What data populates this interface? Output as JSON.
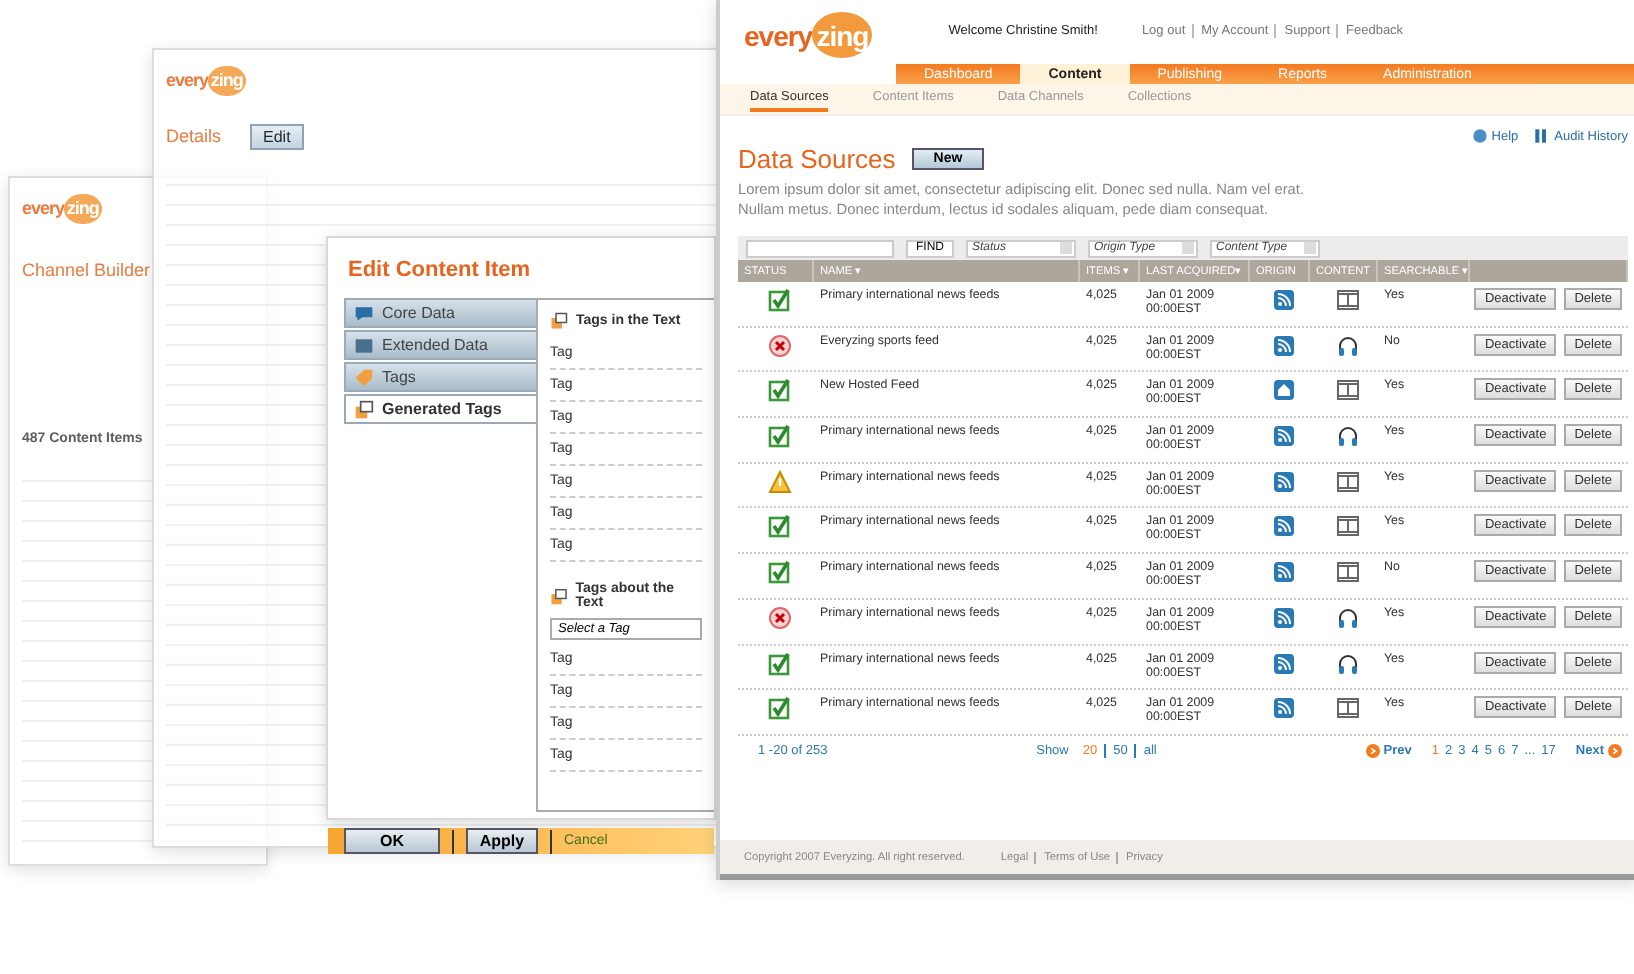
{
  "back_screens": [
    {
      "kind": "channel",
      "logo": {
        "word": "every",
        "mark": "zing"
      },
      "title": "Channel Builder",
      "subtitle": "487 Content Items"
    },
    {
      "kind": "details",
      "logo": {
        "word": "every",
        "mark": "zing"
      },
      "title": "Details",
      "button": "Edit"
    }
  ],
  "dialog": {
    "title": "Edit Content Item",
    "tabs": [
      {
        "label": "Core Data",
        "kind": "core",
        "selected": false
      },
      {
        "label": "Extended Data",
        "kind": "extended",
        "selected": false
      },
      {
        "label": "Tags",
        "kind": "tags",
        "selected": false
      },
      {
        "label": "Generated Tags",
        "kind": "generated",
        "selected": true
      }
    ],
    "sections": [
      {
        "title": "Tags in the Text",
        "tags": [
          "Tag",
          "Tag",
          "Tag",
          "Tag",
          "Tag",
          "Tag",
          "Tag"
        ]
      },
      {
        "title": "Tags about the Text",
        "select": "Select a Tag",
        "tags": [
          "Tag",
          "Tag",
          "Tag",
          "Tag"
        ]
      }
    ],
    "buttons": [
      "OK",
      "Apply"
    ],
    "cancel": "Cancel"
  },
  "main": {
    "logo": {
      "word": "every",
      "mark": "zing"
    },
    "welcome": "Welcome Christine Smith!",
    "links": [
      "Log out",
      "My Account",
      "Support",
      "Feedback"
    ],
    "tabs": [
      {
        "label": "Dashboard",
        "selected": false
      },
      {
        "label": "Content",
        "selected": true
      },
      {
        "label": "Publishing",
        "selected": false
      },
      {
        "label": "Reports",
        "selected": false
      },
      {
        "label": "Administration",
        "selected": false
      }
    ],
    "subtabs": [
      {
        "label": "Data Sources",
        "selected": true
      },
      {
        "label": "Content Items",
        "selected": false
      },
      {
        "label": "Data Channels",
        "selected": false
      },
      {
        "label": "Collections",
        "selected": false
      }
    ],
    "help": "Help",
    "audit": "Audit History",
    "title": "Data Sources",
    "new_button": "New",
    "description": "Lorem ipsum dolor sit amet, consectetur adipiscing elit. Donec sed nulla. Nam vel erat. Nullam metus. Donec interdum, lectus id sodales aliquam, pede diam consequat.",
    "find": "FIND",
    "filters": [
      "Status",
      "Origin Type",
      "Content Type"
    ],
    "columns": [
      "STATUS",
      "NAME ▾",
      "ITEMS ▾",
      "LAST ACQUIRED▾",
      "ORIGIN",
      "CONTENT",
      "SEARCHABLE ▾"
    ],
    "rows": [
      {
        "status": {
          "kind": "ok"
        },
        "name": "Primary international news feeds",
        "items": "4,025",
        "date": "Jan 01 2009",
        "time": "00:00EST",
        "origin": {
          "kind": "rss"
        },
        "content": {
          "kind": "video"
        },
        "searchable": "Yes",
        "actions": [
          "Deactivate",
          "Delete"
        ]
      },
      {
        "status": {
          "kind": "error"
        },
        "name": "Everyzing sports feed",
        "items": "4,025",
        "date": "Jan 01 2009",
        "time": "00:00EST",
        "origin": {
          "kind": "rss"
        },
        "content": {
          "kind": "audio"
        },
        "searchable": "No",
        "actions": [
          "Deactivate",
          "Delete"
        ]
      },
      {
        "status": {
          "kind": "ok"
        },
        "name": "New Hosted Feed",
        "items": "4,025",
        "date": "Jan 01 2009",
        "time": "00:00EST",
        "origin": {
          "kind": "home"
        },
        "content": {
          "kind": "video"
        },
        "searchable": "Yes",
        "actions": [
          "Deactivate",
          "Delete"
        ]
      },
      {
        "status": {
          "kind": "ok"
        },
        "name": "Primary international news feeds",
        "items": "4,025",
        "date": "Jan 01 2009",
        "time": "00:00EST",
        "origin": {
          "kind": "rss"
        },
        "content": {
          "kind": "audio"
        },
        "searchable": "Yes",
        "actions": [
          "Deactivate",
          "Delete"
        ]
      },
      {
        "status": {
          "kind": "warning"
        },
        "name": "Primary international news feeds",
        "items": "4,025",
        "date": "Jan 01 2009",
        "time": "00:00EST",
        "origin": {
          "kind": "rss"
        },
        "content": {
          "kind": "video"
        },
        "searchable": "Yes",
        "actions": [
          "Deactivate",
          "Delete"
        ]
      },
      {
        "status": {
          "kind": "ok"
        },
        "name": "Primary international news feeds",
        "items": "4,025",
        "date": "Jan 01 2009",
        "time": "00:00EST",
        "origin": {
          "kind": "rss"
        },
        "content": {
          "kind": "video"
        },
        "searchable": "Yes",
        "actions": [
          "Deactivate",
          "Delete"
        ]
      },
      {
        "status": {
          "kind": "ok"
        },
        "name": "Primary international news feeds",
        "items": "4,025",
        "date": "Jan 01 2009",
        "time": "00:00EST",
        "origin": {
          "kind": "rss"
        },
        "content": {
          "kind": "video"
        },
        "searchable": "No",
        "actions": [
          "Deactivate",
          "Delete"
        ]
      },
      {
        "status": {
          "kind": "error"
        },
        "name": "Primary international news feeds",
        "items": "4,025",
        "date": "Jan 01 2009",
        "time": "00:00EST",
        "origin": {
          "kind": "rss"
        },
        "content": {
          "kind": "audio"
        },
        "searchable": "Yes",
        "actions": [
          "Deactivate",
          "Delete"
        ]
      },
      {
        "status": {
          "kind": "ok"
        },
        "name": "Primary international news feeds",
        "items": "4,025",
        "date": "Jan 01 2009",
        "time": "00:00EST",
        "origin": {
          "kind": "rss"
        },
        "content": {
          "kind": "audio"
        },
        "searchable": "Yes",
        "actions": [
          "Deactivate",
          "Delete"
        ]
      },
      {
        "status": {
          "kind": "ok"
        },
        "name": "Primary international news feeds",
        "items": "4,025",
        "date": "Jan 01 2009",
        "time": "00:00EST",
        "origin": {
          "kind": "rss"
        },
        "content": {
          "kind": "video"
        },
        "searchable": "Yes",
        "actions": [
          "Deactivate",
          "Delete"
        ]
      }
    ],
    "pagination": {
      "range": "1 -20 of 253",
      "show": "Show",
      "sizes": [
        {
          "label": "20",
          "selected": true
        },
        {
          "label": "50",
          "selected": false
        },
        {
          "label": "all",
          "selected": false
        }
      ],
      "prev": "Prev",
      "pages": [
        {
          "label": "1",
          "selected": true
        },
        {
          "label": "2",
          "selected": false
        },
        {
          "label": "3",
          "selected": false
        },
        {
          "label": "4",
          "selected": false
        },
        {
          "label": "5",
          "selected": false
        },
        {
          "label": "6",
          "selected": false
        },
        {
          "label": "7",
          "selected": false
        }
      ],
      "ellipsis": "...",
      "last": "17",
      "next": "Next"
    },
    "footer": {
      "copyright": "Copyright 2007 Everyzing. All right reserved.",
      "links": [
        "Legal",
        "Terms of Use",
        "Privacy"
      ]
    }
  }
}
